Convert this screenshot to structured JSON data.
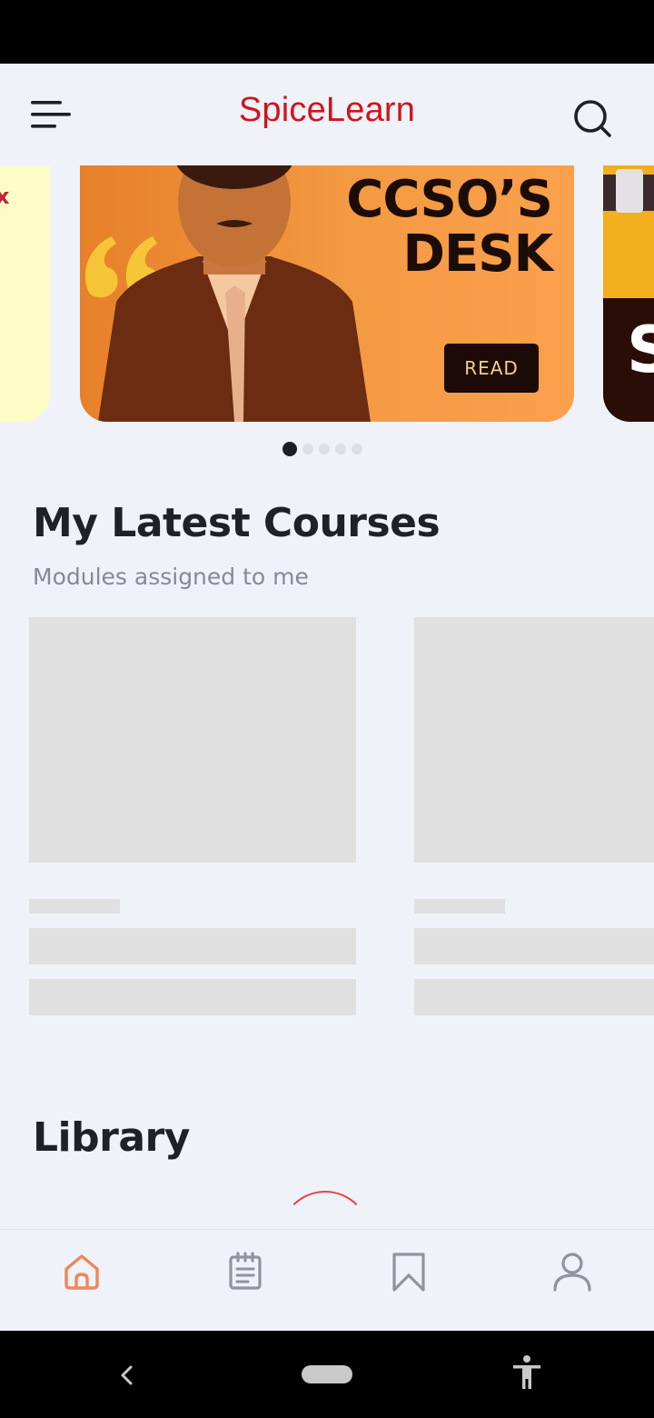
{
  "app": {
    "title": "SpiceLearn"
  },
  "banner": {
    "headline_line1": "CCSO’S",
    "headline_line2": "DESK",
    "button_label": "READ",
    "pages": 5,
    "active_page": 1
  },
  "courses": {
    "title": "My Latest Courses",
    "subtitle": "Modules assigned to me"
  },
  "library": {
    "title": "Library"
  },
  "bottom_nav": {
    "items": [
      "home",
      "assignments",
      "bookmarks",
      "profile"
    ],
    "active": "home"
  },
  "colors": {
    "brand_red": "#d0141d",
    "active_nav": "#f0855a",
    "inactive_nav": "#8f949e",
    "background": "#eff2f8"
  }
}
